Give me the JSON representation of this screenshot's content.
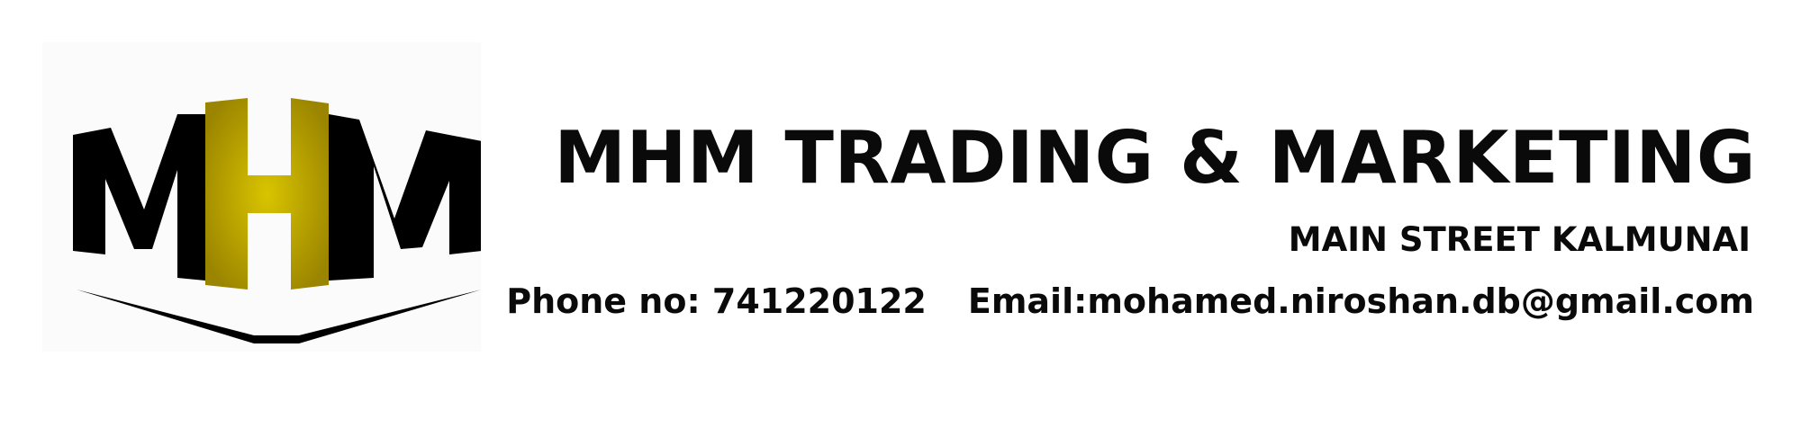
{
  "logo": {
    "text": "MHM",
    "colors": {
      "black": "#000000",
      "gold_light": "#d9c400",
      "gold_dark": "#9b8500",
      "background": "#fbfbfb"
    }
  },
  "header": {
    "company_name": "MHM TRADING & MARKETING",
    "address": "MAIN STREET KALMUNAI"
  },
  "contact": {
    "phone_label": "Phone no:",
    "phone_value": "741220122",
    "email_label": "Email:",
    "email_value": "mohamed.niroshan.db@gmail.com"
  }
}
